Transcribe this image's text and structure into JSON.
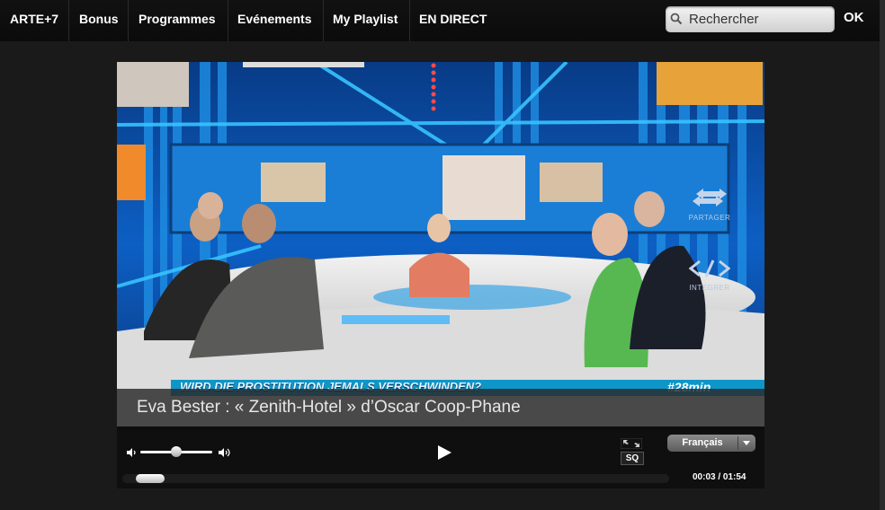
{
  "nav": {
    "items": [
      {
        "label": "ARTE+7"
      },
      {
        "label": "Bonus"
      },
      {
        "label": "Programmes"
      },
      {
        "label": "Evénements"
      },
      {
        "label": "My Playlist"
      },
      {
        "label": "EN DIRECT"
      }
    ],
    "search_placeholder": "Rechercher",
    "ok_label": "OK"
  },
  "player": {
    "ticker_text": "WIRD DIE PROSTITUTION JEMALS VERSCHWINDEN?",
    "ticker_tag": "#28min",
    "subtitle": "Eva Bester : « Zenith-Hotel » d’Oscar Coop-Phane",
    "share_label": "PARTAGER",
    "embed_label": "INTEGRER",
    "quality_label": "SQ",
    "language": "Français",
    "time": "00:03 / 01:54",
    "progress_fraction": 0.026,
    "volume_fraction": 0.5,
    "icons": {
      "volume_low": "volume-low-icon",
      "volume_high": "volume-high-icon",
      "play": "play-icon",
      "fullscreen": "fullscreen-icon",
      "share": "share-arrows-icon",
      "embed": "embed-code-icon",
      "search": "search-icon",
      "dropdown": "chevron-down-icon"
    }
  },
  "colors": {
    "nav_bg": "#0b0b0b",
    "page_bg": "#1a1a1a",
    "ticker": "#0e96c9",
    "studio_blue": "#0a5ec2"
  }
}
